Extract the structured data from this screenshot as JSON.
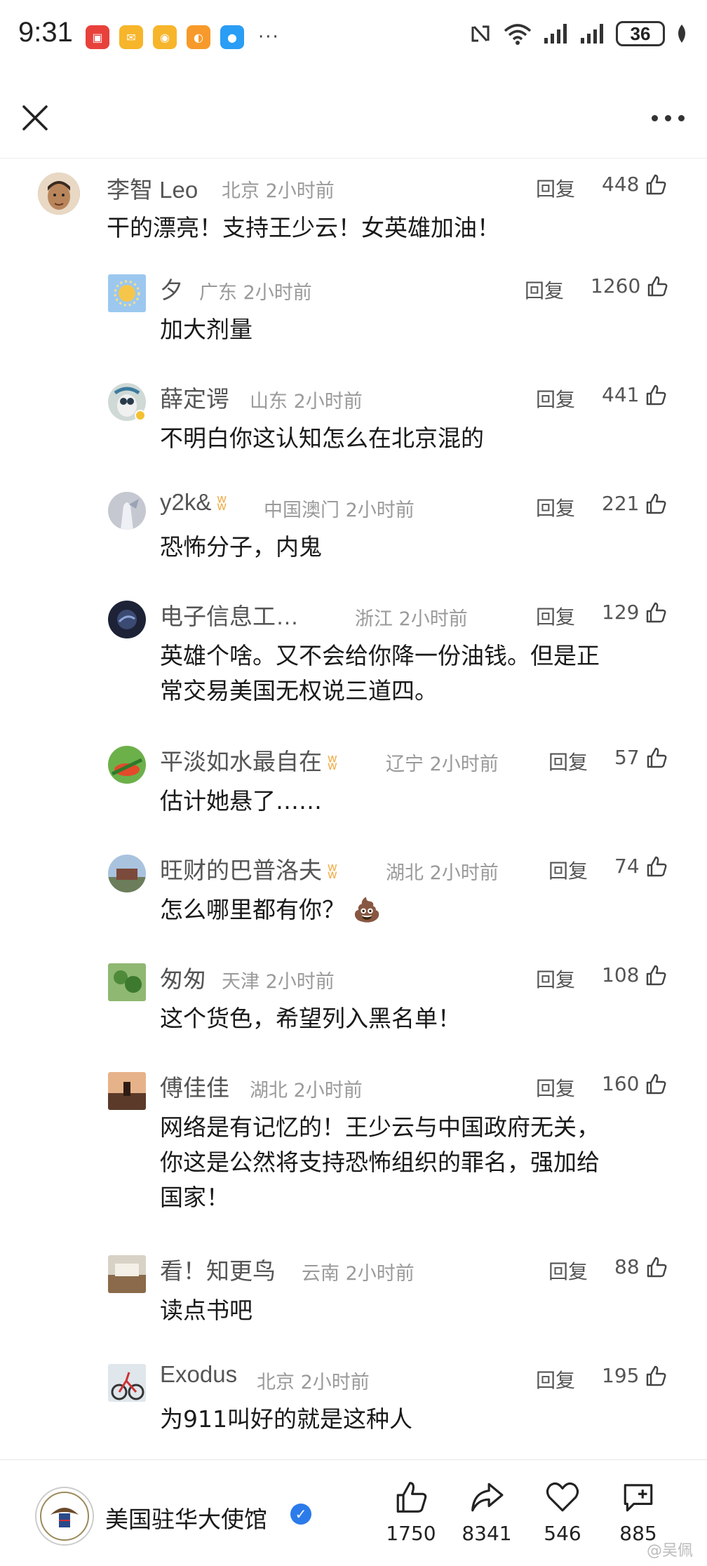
{
  "status": {
    "time": "9:31",
    "dots": "···",
    "battery": "36",
    "app_icons": [
      "huawei-app-icon",
      "mail-icon",
      "weibo-icon",
      "app-icon",
      "message-icon"
    ]
  },
  "comments": [
    {
      "name": "李智 Leo",
      "location": "北京",
      "time": "2小时前",
      "reply": "回复",
      "likes": "448",
      "text": "干的漂亮！支持王少云！女英雄加油！"
    },
    {
      "name": "夕",
      "location": "广东",
      "time": "2小时前",
      "reply": "回复",
      "likes": "1260",
      "text": "加大剂量"
    },
    {
      "name": "薛定谔",
      "location": "山东",
      "time": "2小时前",
      "reply": "回复",
      "likes": "441",
      "text": "不明白你这认知怎么在北京混的"
    },
    {
      "name": "y2k&",
      "location": "中国澳门",
      "time": "2小时前",
      "reply": "回复",
      "likes": "221",
      "text": "恐怖分子，内鬼"
    },
    {
      "name": "电子信息工…",
      "location": "浙江",
      "time": "2小时前",
      "reply": "回复",
      "likes": "129",
      "text_lines": [
        "英雄个啥。又不会给你降一份油钱。但是正",
        "常交易美国无权说三道四。"
      ]
    },
    {
      "name": "平淡如水最自在",
      "location": "辽宁",
      "time": "2小时前",
      "reply": "回复",
      "likes": "57",
      "text": "估计她悬了……"
    },
    {
      "name": "旺财的巴普洛夫",
      "location": "湖北",
      "time": "2小时前",
      "reply": "回复",
      "likes": "74",
      "text": "怎么哪里都有你？ 💩"
    },
    {
      "name": "匆匆",
      "location": "天津",
      "time": "2小时前",
      "reply": "回复",
      "likes": "108",
      "text": "这个货色，希望列入黑名单！"
    },
    {
      "name": "傅佳佳",
      "location": "湖北",
      "time": "2小时前",
      "reply": "回复",
      "likes": "160",
      "text_lines": [
        "网络是有记忆的！王少云与中国政府无关，",
        "你这是公然将支持恐怖组织的罪名，强加给",
        "国家！"
      ]
    },
    {
      "name": "看！知更鸟",
      "location": "云南",
      "time": "2小时前",
      "reply": "回复",
      "likes": "88",
      "text": "读点书吧"
    },
    {
      "name": "Exodus",
      "location": "北京",
      "time": "2小时前",
      "reply": "回复",
      "likes": "195",
      "text": "为911叫好的就是这种人"
    }
  ],
  "account": {
    "name": "美国驻华大使馆",
    "likes": "1750",
    "shares": "8341",
    "favorites": "546",
    "comments": "885"
  },
  "watermark": "@吴佩",
  "colors": {
    "text": "#1a1a1a",
    "meta": "#9a9a9a",
    "verify": "#2b7bea",
    "badge": "#f0b050"
  }
}
